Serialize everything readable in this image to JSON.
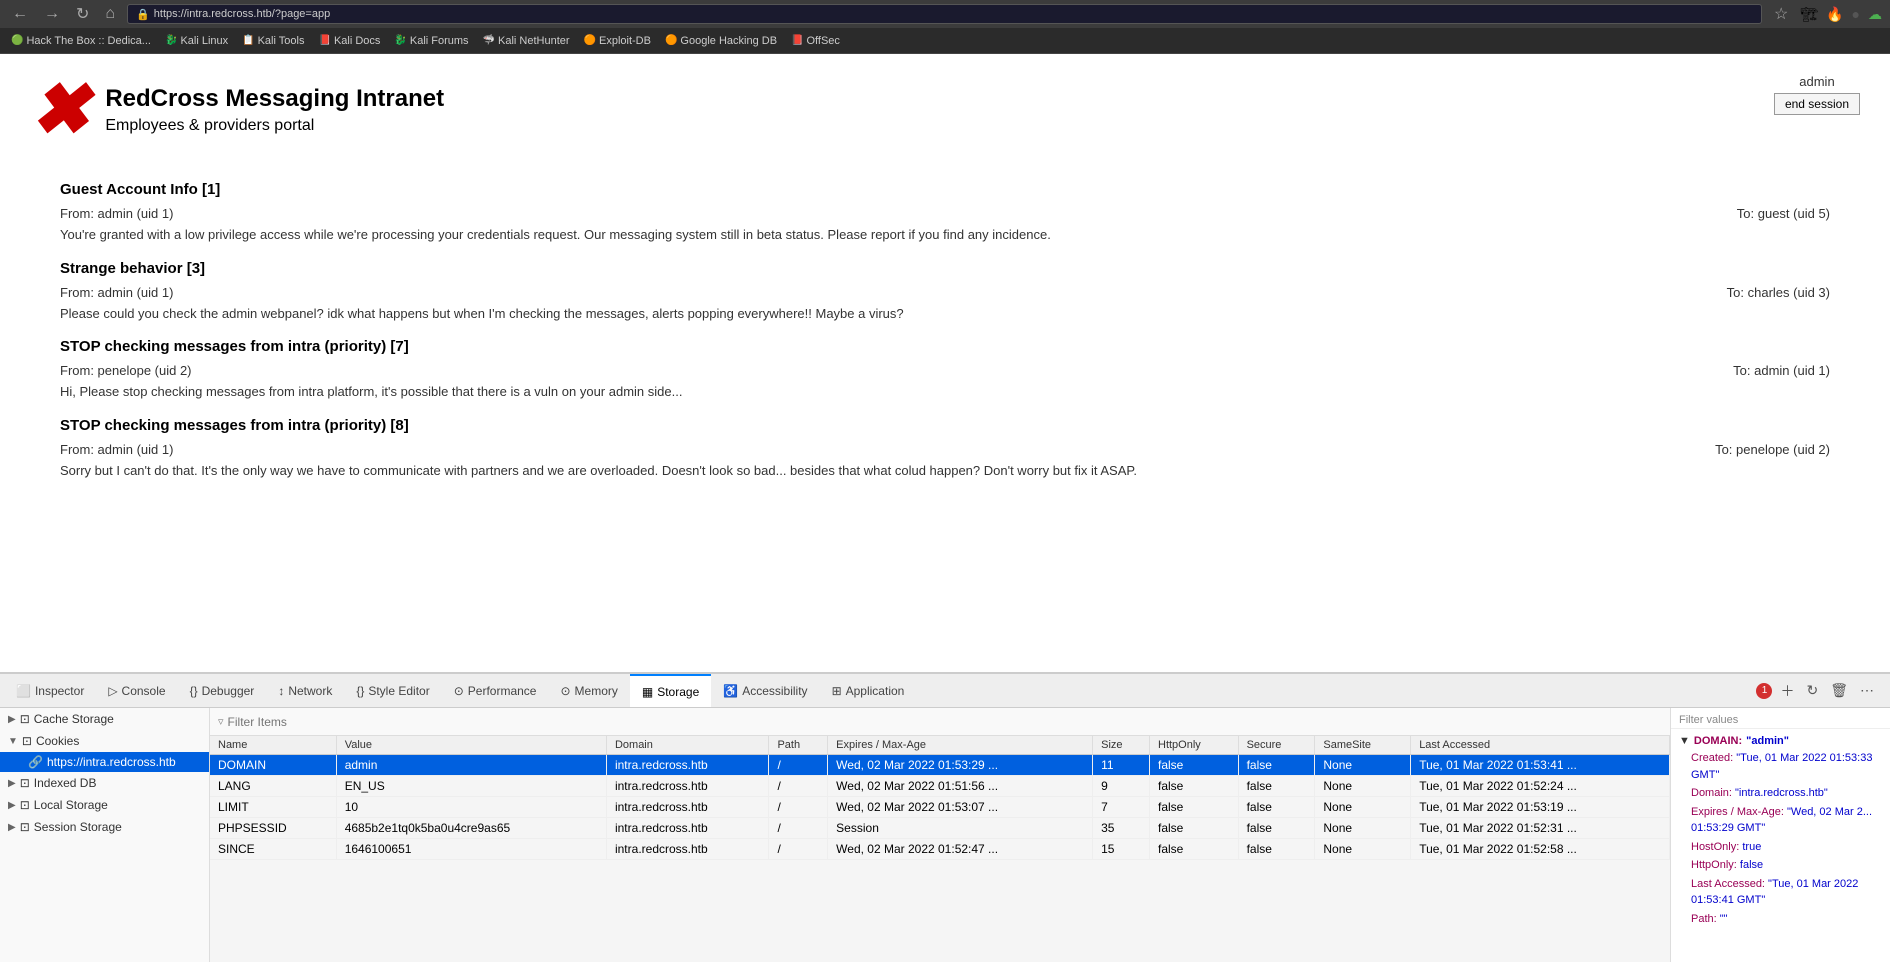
{
  "browser": {
    "back_btn": "←",
    "forward_btn": "→",
    "refresh_btn": "↻",
    "home_btn": "⌂",
    "url": "https://intra.redcross.htb/?page=app",
    "lock_icon": "🔒",
    "star_icon": "☆"
  },
  "bookmarks": [
    {
      "label": "Hack The Box :: Dedica...",
      "icon": "🟢"
    },
    {
      "label": "Kali Linux",
      "icon": "🐉"
    },
    {
      "label": "Kali Tools",
      "icon": "📋"
    },
    {
      "label": "Kali Docs",
      "icon": "📕"
    },
    {
      "label": "Kali Forums",
      "icon": "🐉"
    },
    {
      "label": "Kali NetHunter",
      "icon": "🦈"
    },
    {
      "label": "Exploit-DB",
      "icon": "🟠"
    },
    {
      "label": "Google Hacking DB",
      "icon": "🟠"
    },
    {
      "label": "OffSec",
      "icon": "📕"
    }
  ],
  "site": {
    "title": "RedCross Messaging Intranet",
    "subtitle": "Employees & providers portal",
    "user": "admin",
    "end_session": "end session"
  },
  "messages": [
    {
      "title": "Guest Account Info [1]",
      "from": "From: admin (uid 1)",
      "to": "To: guest (uid 5)",
      "body": "You're granted with a low privilege access while we're processing your credentials request. Our messaging system still in beta status. Please report if you find any incidence."
    },
    {
      "title": "Strange behavior [3]",
      "from": "From: admin (uid 1)",
      "to": "To: charles (uid 3)",
      "body": "Please could you check the admin webpanel? idk what happens but when I'm checking the messages, alerts popping everywhere!! Maybe a virus?"
    },
    {
      "title": "STOP checking messages from intra (priority) [7]",
      "from": "From: penelope (uid 2)",
      "to": "To: admin (uid 1)",
      "body": "Hi, Please stop checking messages from intra platform, it's possible that there is a vuln on your admin side..."
    },
    {
      "title": "STOP checking messages from intra (priority) [8]",
      "from": "From: admin (uid 1)",
      "to": "To: penelope (uid 2)",
      "body": "Sorry but I can't do that. It's the only way we have to communicate with partners and we are overloaded. Doesn't look so bad... besides that what colud happen? Don't worry but fix it ASAP."
    }
  ],
  "devtools": {
    "tabs": [
      {
        "label": "Inspector",
        "icon": "⬜"
      },
      {
        "label": "Console",
        "icon": "▷"
      },
      {
        "label": "Debugger",
        "icon": "{}"
      },
      {
        "label": "Network",
        "icon": "↕"
      },
      {
        "label": "Style Editor",
        "icon": "{}"
      },
      {
        "label": "Performance",
        "icon": "⊙"
      },
      {
        "label": "Memory",
        "icon": "⊙"
      },
      {
        "label": "Storage",
        "icon": "▦",
        "active": true
      },
      {
        "label": "Accessibility",
        "icon": "♿"
      },
      {
        "label": "Application",
        "icon": "⊞"
      }
    ],
    "error_count": "1"
  },
  "storage": {
    "sidebar": {
      "groups": [
        {
          "name": "Cache Storage",
          "icon": "▶",
          "expanded": false,
          "items": []
        },
        {
          "name": "Cookies",
          "icon": "▼",
          "expanded": true,
          "items": [
            {
              "label": "https://intra.redcross.htb",
              "active": true
            }
          ]
        },
        {
          "name": "Indexed DB",
          "icon": "▶",
          "expanded": false,
          "items": []
        },
        {
          "name": "Local Storage",
          "icon": "▶",
          "expanded": false,
          "items": []
        },
        {
          "name": "Session Storage",
          "icon": "▶",
          "expanded": false,
          "items": []
        }
      ]
    },
    "filter_placeholder": "Filter Items",
    "filter_values_label": "Filter values",
    "columns": [
      "Name",
      "Value",
      "Domain",
      "Path",
      "Expires / Max-Age",
      "Size",
      "HttpOnly",
      "Secure",
      "SameSite",
      "Last Accessed"
    ],
    "cookies": [
      {
        "name": "DOMAIN",
        "value": "admin",
        "domain": "intra.redcross.htb",
        "path": "/",
        "expires": "Wed, 02 Mar 2022 01:53:29 ...",
        "size": "11",
        "httponly": "false",
        "secure": "false",
        "samesite": "None",
        "last_accessed": "Tue, 01 Mar 2022 01:53:41 ...",
        "selected": true
      },
      {
        "name": "LANG",
        "value": "EN_US",
        "domain": "intra.redcross.htb",
        "path": "/",
        "expires": "Wed, 02 Mar 2022 01:51:56 ...",
        "size": "9",
        "httponly": "false",
        "secure": "false",
        "samesite": "None",
        "last_accessed": "Tue, 01 Mar 2022 01:52:24 ...",
        "selected": false
      },
      {
        "name": "LIMIT",
        "value": "10",
        "domain": "intra.redcross.htb",
        "path": "/",
        "expires": "Wed, 02 Mar 2022 01:53:07 ...",
        "size": "7",
        "httponly": "false",
        "secure": "false",
        "samesite": "None",
        "last_accessed": "Tue, 01 Mar 2022 01:53:19 ...",
        "selected": false
      },
      {
        "name": "PHPSESSID",
        "value": "4685b2e1tq0k5ba0u4cre9as65",
        "domain": "intra.redcross.htb",
        "path": "/",
        "expires": "Session",
        "size": "35",
        "httponly": "false",
        "secure": "false",
        "samesite": "None",
        "last_accessed": "Tue, 01 Mar 2022 01:52:31 ...",
        "selected": false
      },
      {
        "name": "SINCE",
        "value": "1646100651",
        "domain": "intra.redcross.htb",
        "path": "/",
        "expires": "Wed, 02 Mar 2022 01:52:47 ...",
        "size": "15",
        "httponly": "false",
        "secure": "false",
        "samesite": "None",
        "last_accessed": "Tue, 01 Mar 2022 01:52:58 ...",
        "selected": false
      }
    ],
    "detail": {
      "section": "DOMAIN",
      "key_label": "DOMAIN:",
      "key_value": "\"admin\"",
      "fields": [
        {
          "key": "Created:",
          "value": "\"Tue, 01 Mar 2022 01:53:33 GMT\""
        },
        {
          "key": "Domain:",
          "value": "\"intra.redcross.htb\""
        },
        {
          "key": "Expires / Max-Age:",
          "value": "\"Wed, 02 Mar 2... 01:53:29 GMT\""
        },
        {
          "key": "HostOnly:",
          "value": "true"
        },
        {
          "key": "HttpOnly:",
          "value": "false"
        },
        {
          "key": "Last Accessed:",
          "value": "\"Tue, 01 Mar 2022 01:53:41 GMT\""
        },
        {
          "key": "Path:",
          "value": "\"\""
        }
      ]
    }
  }
}
